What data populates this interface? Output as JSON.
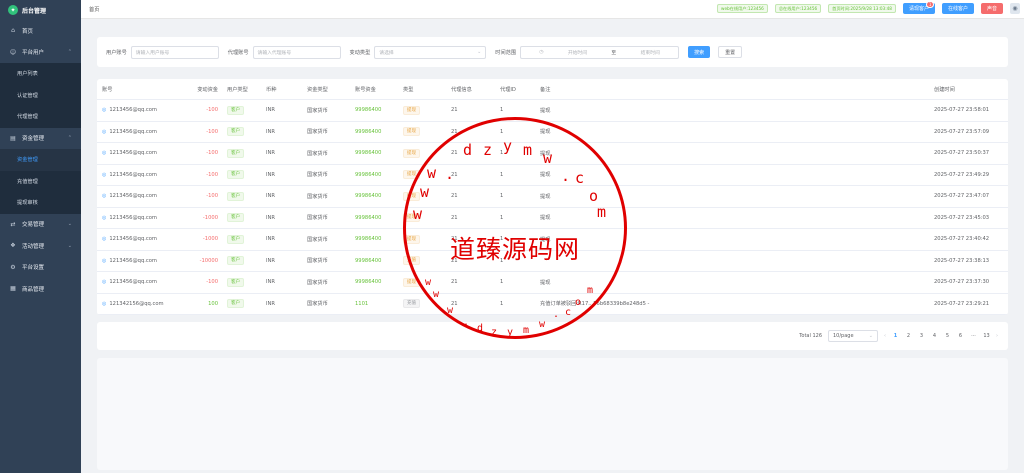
{
  "app": {
    "title": "后台管理",
    "logo_icon": "leaf-icon"
  },
  "sidebar": {
    "items": [
      {
        "label": "首页",
        "icon": "home-icon"
      },
      {
        "label": "平台用户",
        "icon": "user-icon",
        "expanded": true,
        "children": [
          "用户列表",
          "认证管理",
          "代理管理"
        ]
      },
      {
        "label": "资金管理",
        "icon": "wallet-icon",
        "expanded": true,
        "children": [
          "资金管理",
          "充值管理",
          "提现审核"
        ]
      },
      {
        "label": "交易管理",
        "icon": "trade-icon"
      },
      {
        "label": "活动管理",
        "icon": "gift-icon"
      },
      {
        "label": "平台设置",
        "icon": "gear-icon"
      },
      {
        "label": "商品管理",
        "icon": "goods-icon"
      }
    ],
    "active_child": "资金管理"
  },
  "header": {
    "breadcrumb": "首页",
    "chips": [
      "web在线用户:123456",
      "总在线用户:123456",
      "首页时间:2025/9/28 13:03:48"
    ],
    "buttons": {
      "online_customers": "请现客户",
      "online_badge": "1",
      "online_users": "在线客户",
      "sound": "声音"
    },
    "avatar_icon": "avatar-icon"
  },
  "filters": {
    "user_account_label": "用户账号",
    "user_account_placeholder": "请输入用户账号",
    "agent_account_label": "代理账号",
    "agent_account_placeholder": "请输入代理账号",
    "change_type_label": "变动类型",
    "change_type_placeholder": "请选择",
    "time_range_label": "时间范围",
    "start_placeholder": "开始时间",
    "range_sep": "至",
    "end_placeholder": "结束时间",
    "search_label": "搜索",
    "reset_label": "重置"
  },
  "table": {
    "columns": [
      "账号",
      "变动资金",
      "用户类型",
      "币种",
      "资金类型",
      "账号资金",
      "类型",
      "代理信息",
      "代理ID",
      "备注",
      "创建时间"
    ],
    "rows": [
      {
        "account": "1213456@qq.com",
        "change": "-100",
        "user_type": "客户",
        "currency": "INR",
        "fund_type": "国家货币",
        "balance": "99986400",
        "type": "提现",
        "agent": "21",
        "agent_id": "1",
        "remark": "提现",
        "created": "2025-07-27 23:58:01"
      },
      {
        "account": "1213456@qq.com",
        "change": "-100",
        "user_type": "客户",
        "currency": "INR",
        "fund_type": "国家货币",
        "balance": "99986400",
        "type": "提现",
        "agent": "21",
        "agent_id": "1",
        "remark": "提现",
        "created": "2025-07-27 23:57:09"
      },
      {
        "account": "1213456@qq.com",
        "change": "-100",
        "user_type": "客户",
        "currency": "INR",
        "fund_type": "国家货币",
        "balance": "99986400",
        "type": "提现",
        "agent": "21",
        "agent_id": "1",
        "remark": "提现",
        "created": "2025-07-27 23:50:37"
      },
      {
        "account": "1213456@qq.com",
        "change": "-100",
        "user_type": "客户",
        "currency": "INR",
        "fund_type": "国家货币",
        "balance": "99986400",
        "type": "提现",
        "agent": "21",
        "agent_id": "1",
        "remark": "提现",
        "created": "2025-07-27 23:49:29"
      },
      {
        "account": "1213456@qq.com",
        "change": "-100",
        "user_type": "客户",
        "currency": "INR",
        "fund_type": "国家货币",
        "balance": "99986400",
        "type": "提现",
        "agent": "21",
        "agent_id": "1",
        "remark": "提现",
        "created": "2025-07-27 23:47:07"
      },
      {
        "account": "1213456@qq.com",
        "change": "-1000",
        "user_type": "客户",
        "currency": "INR",
        "fund_type": "国家货币",
        "balance": "99986400",
        "type": "提现",
        "agent": "21",
        "agent_id": "1",
        "remark": "提现",
        "created": "2025-07-27 23:45:03"
      },
      {
        "account": "1213456@qq.com",
        "change": "-1000",
        "user_type": "客户",
        "currency": "INR",
        "fund_type": "国家货币",
        "balance": "99986400",
        "type": "提现",
        "agent": "21",
        "agent_id": "1",
        "remark": "提现",
        "created": "2025-07-27 23:40:42"
      },
      {
        "account": "1213456@qq.com",
        "change": "-10000",
        "user_type": "客户",
        "currency": "INR",
        "fund_type": "国家货币",
        "balance": "99986400",
        "type": "充值",
        "agent": "21",
        "agent_id": "1",
        "remark": "",
        "created": "2025-07-27 23:38:13"
      },
      {
        "account": "1213456@qq.com",
        "change": "-100",
        "user_type": "客户",
        "currency": "INR",
        "fund_type": "国家货币",
        "balance": "99986400",
        "type": "提现",
        "agent": "21",
        "agent_id": "1",
        "remark": "提现",
        "created": "2025-07-27 23:37:30"
      },
      {
        "account": "121342156@qq.com",
        "change": "100",
        "user_type": "客户",
        "currency": "INR",
        "fund_type": "国家货币",
        "balance": "1101",
        "type": "充值",
        "agent": "21",
        "agent_id": "1",
        "remark": "充值订单被驳回:R17...56b68339b8e248d5 -",
        "created": "2025-07-27 23:29:21"
      }
    ]
  },
  "pagination": {
    "total": "Total 126",
    "page_size": "10/page",
    "pages": [
      "1",
      "2",
      "3",
      "4",
      "5",
      "6",
      "···",
      "13"
    ],
    "current": "1",
    "prev_icon": "chevron-left-icon",
    "next_icon": "chevron-right-icon"
  },
  "watermark": {
    "text": "道臻源码网",
    "url_chars_top": [
      "w",
      "w",
      "w",
      ".",
      "d",
      "z",
      "y",
      "m",
      "w",
      ".",
      "c",
      "o",
      "m"
    ],
    "url_chars_bottom": [
      "w",
      "w",
      "w",
      ".",
      "d",
      "z",
      "y",
      "m",
      "w",
      ".",
      "c",
      "o",
      "m"
    ]
  }
}
